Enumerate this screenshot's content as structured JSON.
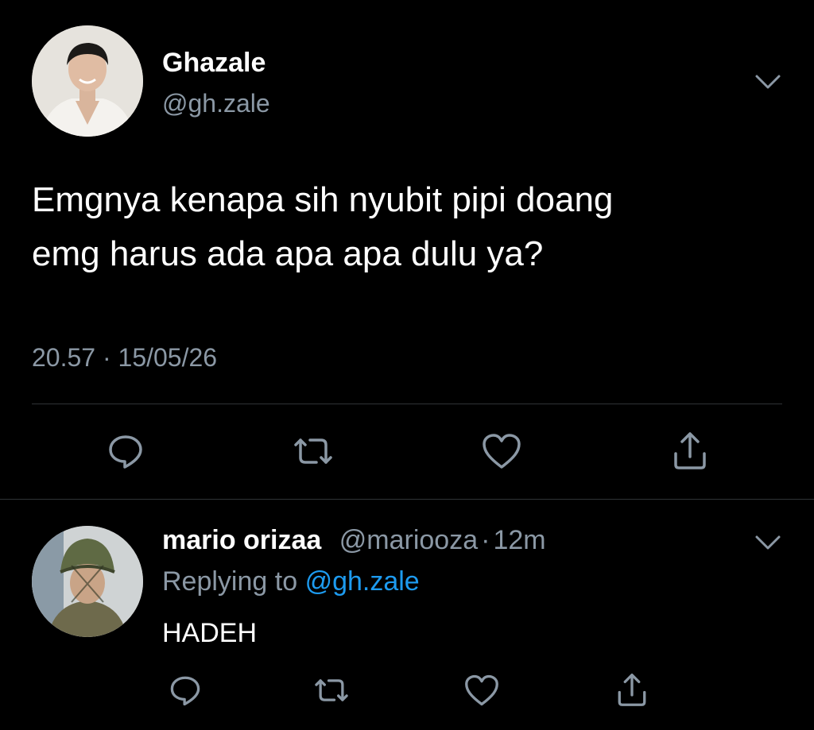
{
  "tweet": {
    "display_name": "Ghazale",
    "handle": "@gh.zale",
    "text_line1": "Emgnya kenapa sih nyubit pipi doang",
    "text_line2": "emg harus ada apa apa dulu ya?",
    "timestamp": "20.57 · 15/05/26",
    "actions": [
      "reply-icon",
      "retweet-icon",
      "like-icon",
      "share-icon"
    ]
  },
  "reply": {
    "display_name": "mario orizaa",
    "handle": "@mariooza",
    "separator": "·",
    "time": "12m",
    "replying_prefix": "Replying to",
    "replying_handle": "@gh.zale",
    "text": "HADEH",
    "actions": [
      "reply-icon",
      "retweet-icon",
      "like-icon",
      "share-icon"
    ]
  },
  "colors": {
    "background": "#000000",
    "secondary_text": "#8b98a5",
    "link": "#1d9bf0",
    "divider": "#2f3336"
  }
}
